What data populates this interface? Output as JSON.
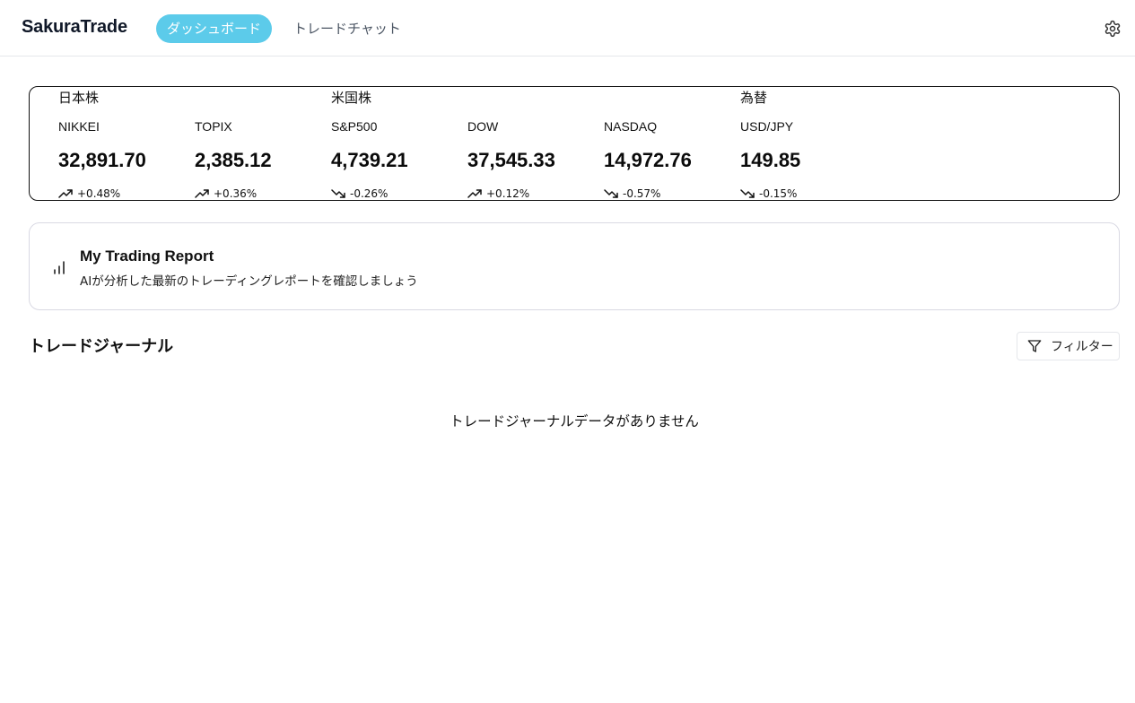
{
  "header": {
    "logo": "SakuraTrade",
    "tabs": [
      {
        "label": "ダッシュボード",
        "active": true
      },
      {
        "label": "トレードチャット",
        "active": false
      }
    ],
    "settings_icon": "gear-icon",
    "accent_color": "#5ccbea"
  },
  "market": {
    "groups": [
      {
        "title": "日本株"
      },
      {
        "title": "米国株"
      },
      {
        "title": "為替"
      }
    ],
    "tickers": [
      {
        "symbol": "NIKKEI",
        "value": "32,891.70",
        "change": "+0.48%",
        "trend": "up"
      },
      {
        "symbol": "TOPIX",
        "value": "2,385.12",
        "change": "+0.36%",
        "trend": "up"
      },
      {
        "symbol": "S&P500",
        "value": "4,739.21",
        "change": "-0.26%",
        "trend": "down"
      },
      {
        "symbol": "DOW",
        "value": "37,545.33",
        "change": "+0.12%",
        "trend": "up"
      },
      {
        "symbol": "NASDAQ",
        "value": "14,972.76",
        "change": "-0.57%",
        "trend": "down"
      },
      {
        "symbol": "USD/JPY",
        "value": "149.85",
        "change": "-0.15%",
        "trend": "down"
      }
    ]
  },
  "report": {
    "icon": "bar-chart-icon",
    "title": "My Trading Report",
    "subtitle": "AIが分析した最新のトレーディングレポートを確認しましょう"
  },
  "journal": {
    "title": "トレードジャーナル",
    "filter_label": "フィルター",
    "filter_icon": "filter-icon",
    "empty_message": "トレードジャーナルデータがありません"
  }
}
